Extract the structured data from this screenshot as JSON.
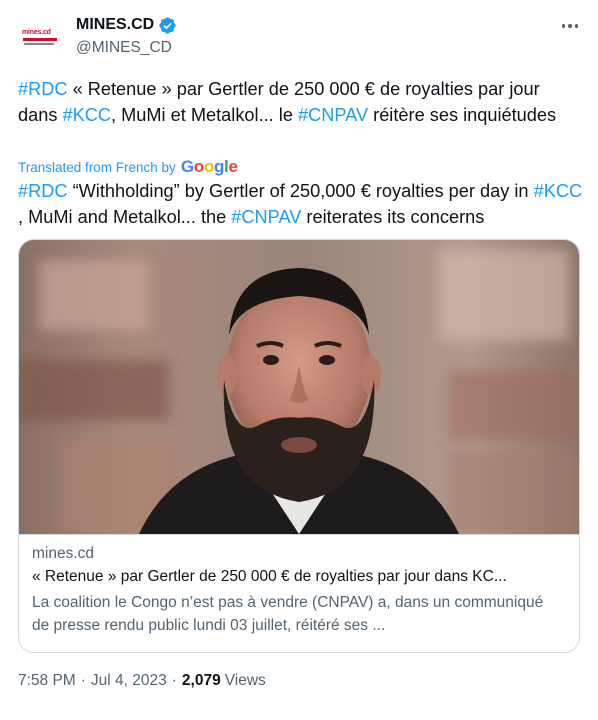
{
  "author": {
    "display_name": "MINES.CD",
    "handle": "@MINES_CD",
    "avatar_text": "mines.cd",
    "verified_icon": "verified-badge-icon",
    "brand_color": "#c8102e"
  },
  "tweet": {
    "line_parts": [
      {
        "text": "#RDC",
        "tag": true
      },
      {
        "text": " « Retenue » par Gertler de 250 000 € de royalties par jour dans ",
        "tag": false
      },
      {
        "text": "#KCC",
        "tag": true
      },
      {
        "text": ", MuMi et Metalkol... le ",
        "tag": false
      },
      {
        "text": "#CNPAV",
        "tag": true
      },
      {
        "text": " réitère ses inquiétudes",
        "tag": false
      }
    ]
  },
  "translation": {
    "label": "Translated from French by",
    "provider": "Google",
    "parts": [
      {
        "text": "#RDC",
        "tag": true
      },
      {
        "text": " “Withholding” by Gertler of 250,000 € royalties per day in ",
        "tag": false
      },
      {
        "text": "#KCC",
        "tag": true
      },
      {
        "text": " , MuMi and Metalkol... the ",
        "tag": false
      },
      {
        "text": "#CNPAV",
        "tag": true
      },
      {
        "text": " reiterates its concerns",
        "tag": false
      }
    ]
  },
  "card": {
    "domain": "mines.cd",
    "title": "« Retenue » par Gertler de 250 000 € de royalties par jour dans KC...",
    "description": "La coalition le Congo n’est pas à vendre (CNPAV) a, dans un communiqué de presse rendu public lundi 03 juillet, réitéré ses ..."
  },
  "footer": {
    "time": "7:58 PM",
    "separator": "·",
    "date": "Jul 4, 2023",
    "views_count": "2,079",
    "views_label": "Views"
  },
  "colors": {
    "hashtag": "#1d9bf0",
    "secondary_text": "#536471",
    "primary_text": "#0f1419",
    "border": "#cfd9de"
  }
}
